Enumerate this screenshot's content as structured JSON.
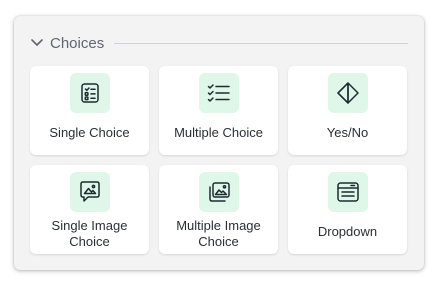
{
  "section": {
    "title": "Choices"
  },
  "colors": {
    "icon_background": "#dff7e9",
    "icon_stroke": "#1f2a33",
    "panel_background": "#f3f3f4"
  },
  "cards": [
    {
      "label": "Single Choice",
      "icon": "single-choice-icon"
    },
    {
      "label": "Multiple Choice",
      "icon": "multiple-choice-icon"
    },
    {
      "label": "Yes/No",
      "icon": "yes-no-icon"
    },
    {
      "label": "Single Image Choice",
      "label_line1": "Single Image",
      "label_line2": "Choice",
      "icon": "single-image-choice-icon"
    },
    {
      "label": "Multiple Image Choice",
      "label_line1": "Multiple Image",
      "label_line2": "Choice",
      "icon": "multiple-image-choice-icon"
    },
    {
      "label": "Dropdown",
      "icon": "dropdown-icon"
    }
  ]
}
